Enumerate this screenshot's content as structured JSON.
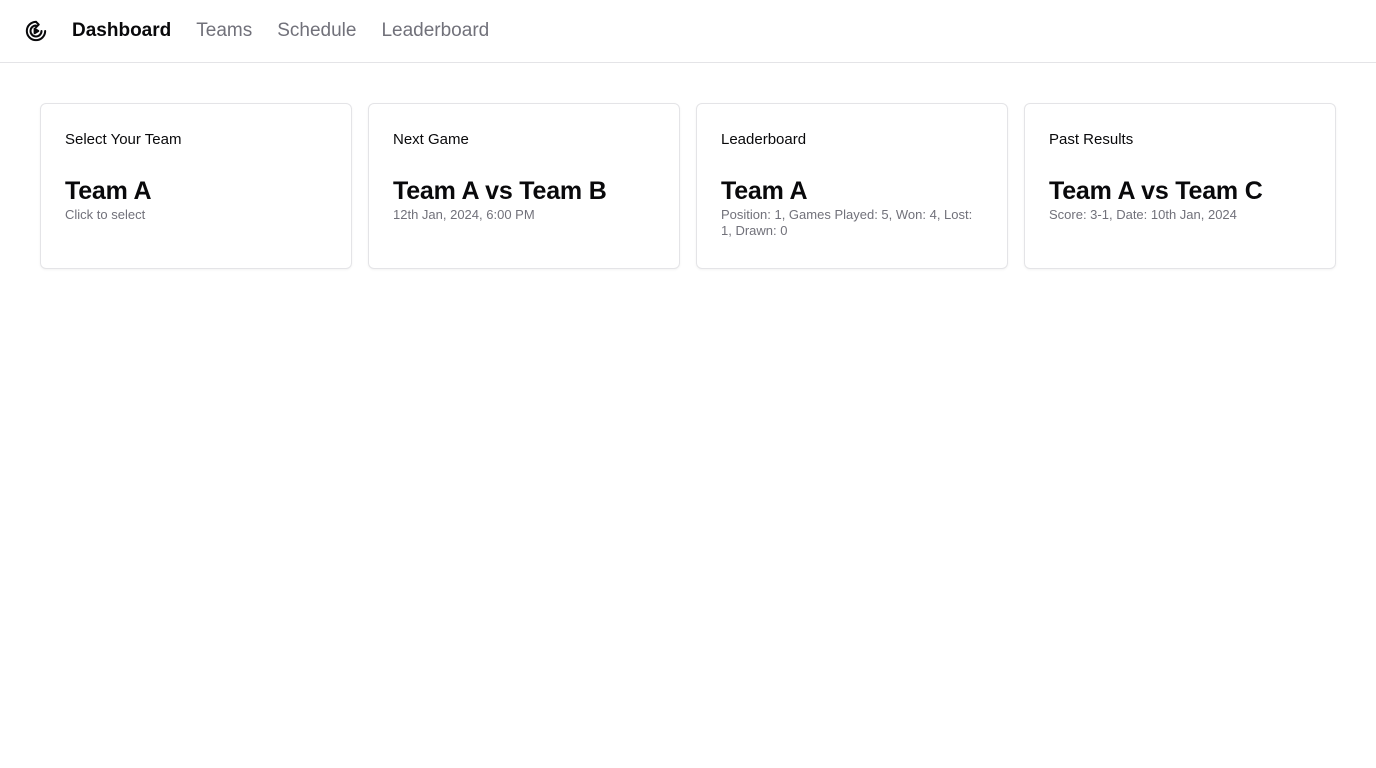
{
  "header": {
    "logo_icon": "refresh-play-icon",
    "nav": [
      {
        "label": "Dashboard",
        "active": true
      },
      {
        "label": "Teams",
        "active": false
      },
      {
        "label": "Schedule",
        "active": false
      },
      {
        "label": "Leaderboard",
        "active": false
      }
    ]
  },
  "cards": [
    {
      "title": "Select Your Team",
      "value": "Team A",
      "desc": "Click to select"
    },
    {
      "title": "Next Game",
      "value": "Team A vs Team B",
      "desc": "12th Jan, 2024, 6:00 PM"
    },
    {
      "title": "Leaderboard",
      "value": "Team A",
      "desc": "Position: 1, Games Played: 5, Won: 4, Lost: 1, Drawn: 0"
    },
    {
      "title": "Past Results",
      "value": "Team A vs Team C",
      "desc": "Score: 3-1, Date: 10th Jan, 2024"
    }
  ],
  "colors": {
    "text": "#09090b",
    "muted": "#71717a",
    "border": "#e4e4e7"
  }
}
